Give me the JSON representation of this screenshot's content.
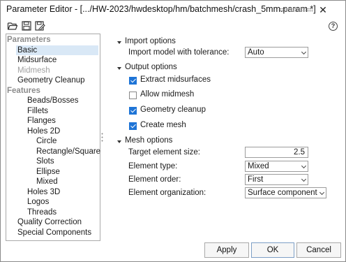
{
  "window": {
    "title": "Parameter Editor - [.../HW-2023/hwdesktop/hm/batchmesh/crash_5mm.param *]",
    "close_glyph": "✕",
    "help_glyph": "?"
  },
  "toolbar": {
    "icons": [
      "open-folder-icon",
      "save-icon",
      "save-as-icon"
    ]
  },
  "tree": {
    "items": [
      {
        "label": "Parameters",
        "kind": "heading"
      },
      {
        "label": "Basic",
        "kind": "item",
        "selected": true
      },
      {
        "label": "Midsurface",
        "kind": "item"
      },
      {
        "label": "Midmesh",
        "kind": "disabled"
      },
      {
        "label": "Geometry Cleanup",
        "kind": "item"
      },
      {
        "label": "Features",
        "kind": "heading"
      },
      {
        "label": "Beads/Bosses",
        "kind": "item"
      },
      {
        "label": "Fillets",
        "kind": "item"
      },
      {
        "label": "Flanges",
        "kind": "item"
      },
      {
        "label": "Holes 2D",
        "kind": "item"
      },
      {
        "label": "Circle",
        "kind": "item"
      },
      {
        "label": "Rectangle/Square",
        "kind": "item"
      },
      {
        "label": "Slots",
        "kind": "item"
      },
      {
        "label": "Ellipse",
        "kind": "item"
      },
      {
        "label": "Mixed",
        "kind": "item"
      },
      {
        "label": "Holes 3D",
        "kind": "item"
      },
      {
        "label": "Logos",
        "kind": "item"
      },
      {
        "label": "Threads",
        "kind": "item"
      },
      {
        "label": "Quality Correction",
        "kind": "item"
      },
      {
        "label": "Special Components",
        "kind": "item"
      }
    ]
  },
  "import_options": {
    "header": "Import options",
    "tolerance_label": "Import model with tolerance:",
    "tolerance_value": "Auto"
  },
  "output_options": {
    "header": "Output options",
    "extract_midsurfaces": {
      "label": "Extract midsurfaces",
      "checked": true
    },
    "allow_midmesh": {
      "label": "Allow midmesh",
      "checked": false
    },
    "geometry_cleanup": {
      "label": "Geometry cleanup",
      "checked": true
    },
    "create_mesh": {
      "label": "Create mesh",
      "checked": true
    }
  },
  "mesh_options": {
    "header": "Mesh options",
    "target_size_label": "Target element size:",
    "target_size_value": "2.5",
    "element_type_label": "Element type:",
    "element_type_value": "Mixed",
    "element_order_label": "Element order:",
    "element_order_value": "First",
    "element_org_label": "Element organization:",
    "element_org_value": "Surface component"
  },
  "buttons": {
    "apply": "Apply",
    "ok": "OK",
    "cancel": "Cancel"
  },
  "colors": {
    "checkbox_accent": "#1e74d6",
    "selection": "#d9e8f6",
    "heading_gray": "#8c8c8c"
  }
}
